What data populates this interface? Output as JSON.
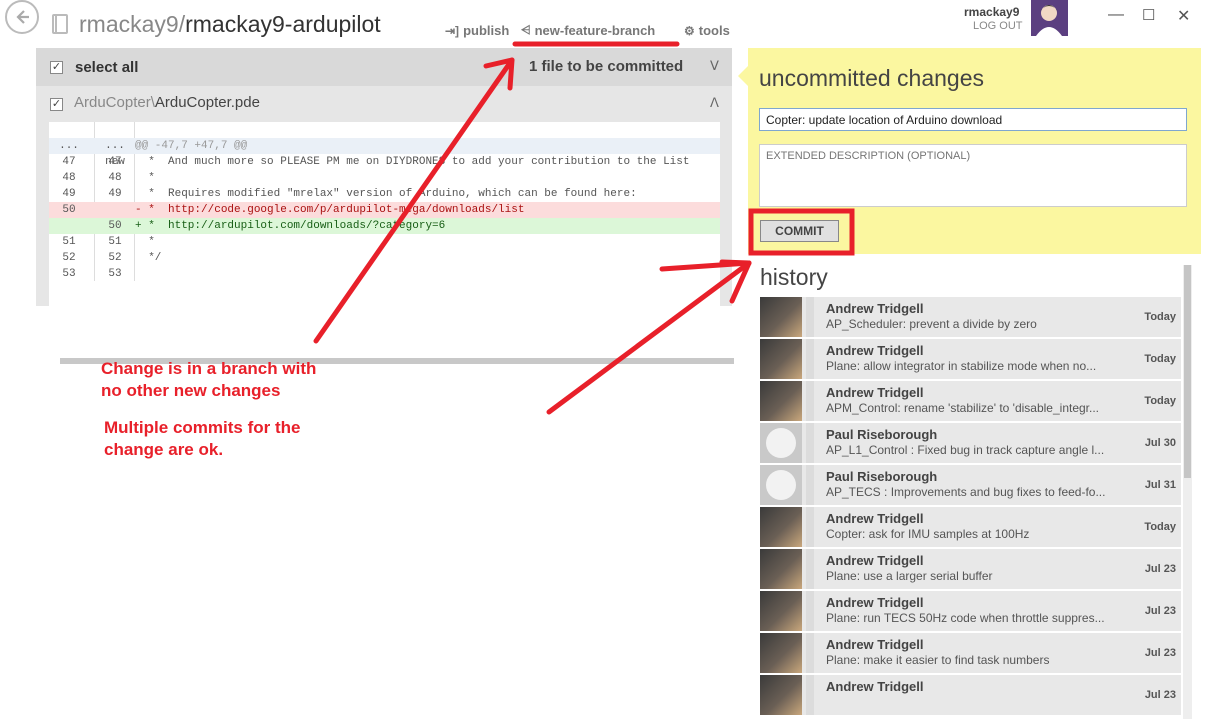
{
  "header": {
    "repo_owner": "rmackay9/",
    "repo_name": "rmackay9-ardupilot",
    "publish_label": "publish",
    "branch_label": "new-feature-branch",
    "tools_label": "tools",
    "user_name": "rmackay9",
    "logout_label": "LOG OUT"
  },
  "changes": {
    "select_all_label": "select all",
    "commit_count_label": "1 file to be committed",
    "file_dir": "ArduCopter\\",
    "file_name": "ArduCopter.pde",
    "diff_header": {
      "old": "old",
      "new": "new"
    },
    "diff_lines": [
      {
        "old": "...",
        "new": "...",
        "code": "@@ -47,7 +47,7 @@",
        "kind": "hunk"
      },
      {
        "old": "47",
        "new": "47",
        "code": "  *  And much more so PLEASE PM me on DIYDRONES to add your contribution to the List",
        "kind": "ctx"
      },
      {
        "old": "48",
        "new": "48",
        "code": "  *",
        "kind": "ctx"
      },
      {
        "old": "49",
        "new": "49",
        "code": "  *  Requires modified \"mrelax\" version of Arduino, which can be found here:",
        "kind": "ctx"
      },
      {
        "old": "50",
        "new": "",
        "code": "- *  http://code.google.com/p/ardupilot-mega/downloads/list",
        "kind": "del"
      },
      {
        "old": "",
        "new": "50",
        "code": "+ *  http://ardupilot.com/downloads/?category=6",
        "kind": "add"
      },
      {
        "old": "51",
        "new": "51",
        "code": "  *",
        "kind": "ctx"
      },
      {
        "old": "52",
        "new": "52",
        "code": "  */",
        "kind": "ctx"
      },
      {
        "old": "53",
        "new": "53",
        "code": "",
        "kind": "ctx"
      }
    ]
  },
  "commit": {
    "title": "uncommitted changes",
    "summary_value": "Copter: update location of Arduino download",
    "description_placeholder": "EXTENDED DESCRIPTION (OPTIONAL)",
    "commit_button": "COMMIT"
  },
  "history": {
    "title": "history",
    "items": [
      {
        "author": "Andrew Tridgell",
        "message": "AP_Scheduler: prevent a divide by zero",
        "date": "Today",
        "avatar": "photo"
      },
      {
        "author": "Andrew Tridgell",
        "message": "Plane: allow integrator in stabilize mode when no...",
        "date": "Today",
        "avatar": "photo"
      },
      {
        "author": "Andrew Tridgell",
        "message": "APM_Control: rename 'stabilize' to 'disable_integr...",
        "date": "Today",
        "avatar": "photo"
      },
      {
        "author": "Paul Riseborough",
        "message": "AP_L1_Control : Fixed bug in track capture angle l...",
        "date": "Jul 30",
        "avatar": "github"
      },
      {
        "author": "Paul Riseborough",
        "message": "AP_TECS : Improvements and bug fixes to feed-fo...",
        "date": "Jul 31",
        "avatar": "github"
      },
      {
        "author": "Andrew Tridgell",
        "message": "Copter: ask for IMU samples at 100Hz",
        "date": "Today",
        "avatar": "photo"
      },
      {
        "author": "Andrew Tridgell",
        "message": "Plane: use a larger serial buffer",
        "date": "Jul 23",
        "avatar": "photo"
      },
      {
        "author": "Andrew Tridgell",
        "message": "Plane: run TECS 50Hz code when throttle suppres...",
        "date": "Jul 23",
        "avatar": "photo"
      },
      {
        "author": "Andrew Tridgell",
        "message": "Plane: make it easier to find task numbers",
        "date": "Jul 23",
        "avatar": "photo"
      },
      {
        "author": "Andrew Tridgell",
        "message": "",
        "date": "Jul 23",
        "avatar": "photo"
      }
    ]
  },
  "annotations": {
    "note1": "Change is in a branch with\nno other new changes",
    "note2": "Multiple commits for the\nchange are ok.",
    "color": "#e8202a"
  }
}
